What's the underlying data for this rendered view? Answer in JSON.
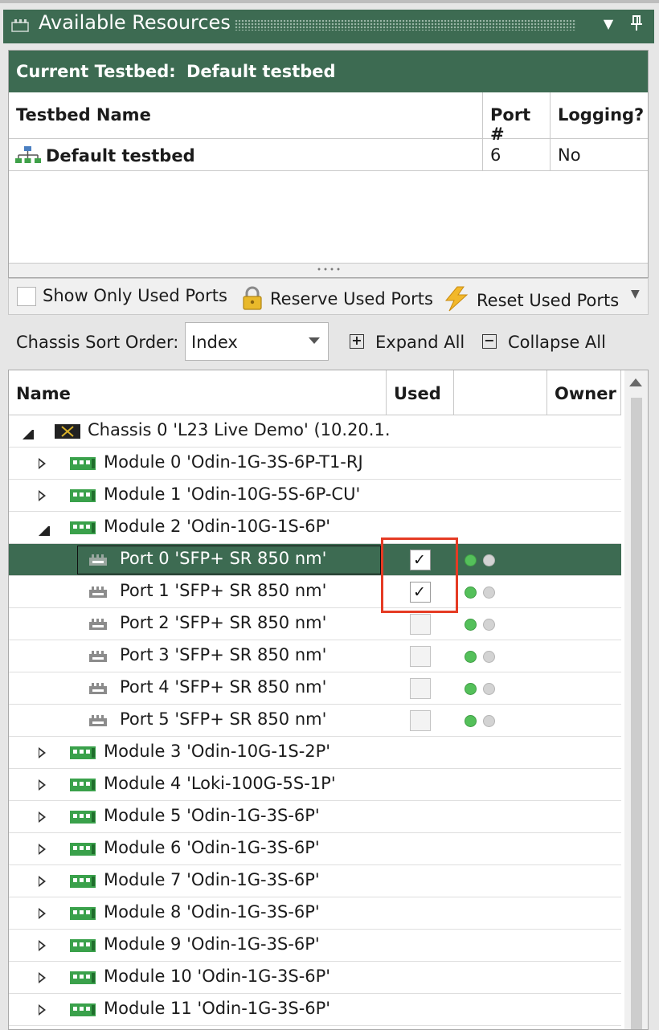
{
  "titlebar": {
    "title": "Available Resources"
  },
  "testbed": {
    "current_label": "Current Testbed:",
    "current_name": "Default testbed",
    "columns": [
      "Testbed Name",
      "Port #",
      "Logging?"
    ],
    "row": {
      "name": "Default testbed",
      "ports": "6",
      "logging": "No"
    }
  },
  "toolbar": {
    "show_only_used": "Show Only Used Ports",
    "reserve": "Reserve Used Ports",
    "reset": "Reset Used Ports"
  },
  "sort": {
    "label": "Chassis Sort Order:",
    "value": "Index",
    "expand_all": "Expand All",
    "collapse_all": "Collapse All"
  },
  "grid": {
    "columns": {
      "name": "Name",
      "used": "Used",
      "status": "",
      "owner": "Owner"
    },
    "rows": [
      {
        "kind": "chassis",
        "label": "Chassis 0 'L23 Live Demo' (10.20.1.",
        "expanded": true
      },
      {
        "kind": "module",
        "label": "Module 0 'Odin-1G-3S-6P-T1-RJ",
        "expanded": false
      },
      {
        "kind": "module",
        "label": "Module 1 'Odin-10G-5S-6P-CU'",
        "expanded": false
      },
      {
        "kind": "module",
        "label": "Module 2 'Odin-10G-1S-6P'",
        "expanded": true
      },
      {
        "kind": "port",
        "label": "Port 0 'SFP+ SR 850 nm'",
        "used": true,
        "selected": true
      },
      {
        "kind": "port",
        "label": "Port 1 'SFP+ SR 850 nm'",
        "used": true
      },
      {
        "kind": "port",
        "label": "Port 2 'SFP+ SR 850 nm'",
        "used": false
      },
      {
        "kind": "port",
        "label": "Port 3 'SFP+ SR 850 nm'",
        "used": false
      },
      {
        "kind": "port",
        "label": "Port 4 'SFP+ SR 850 nm'",
        "used": false
      },
      {
        "kind": "port",
        "label": "Port 5 'SFP+ SR 850 nm'",
        "used": false
      },
      {
        "kind": "module",
        "label": "Module 3 'Odin-10G-1S-2P'",
        "expanded": false
      },
      {
        "kind": "module",
        "label": "Module 4 'Loki-100G-5S-1P'",
        "expanded": false
      },
      {
        "kind": "module",
        "label": "Module 5 'Odin-1G-3S-6P'",
        "expanded": false
      },
      {
        "kind": "module",
        "label": "Module 6 'Odin-1G-3S-6P'",
        "expanded": false
      },
      {
        "kind": "module",
        "label": "Module 7 'Odin-1G-3S-6P'",
        "expanded": false
      },
      {
        "kind": "module",
        "label": "Module 8 'Odin-1G-3S-6P'",
        "expanded": false
      },
      {
        "kind": "module",
        "label": "Module 9 'Odin-1G-3S-6P'",
        "expanded": false
      },
      {
        "kind": "module",
        "label": "Module 10 'Odin-1G-3S-6P'",
        "expanded": false
      },
      {
        "kind": "module",
        "label": "Module 11 'Odin-1G-3S-6P'",
        "expanded": false
      }
    ]
  },
  "colors": {
    "accent": "#3d6b52",
    "highlight": "#e53b24",
    "status_green": "#54c05a",
    "status_grey": "#d3d3d3"
  },
  "icons": {
    "title": "network-card-icon",
    "testbed": "network-tree-icon",
    "reserve": "lock-icon",
    "reset": "lightning-icon",
    "expand": "plus-box-icon",
    "collapse": "minus-box-icon",
    "chassis": "chassis-icon",
    "module": "module-card-icon",
    "port": "port-icon"
  }
}
